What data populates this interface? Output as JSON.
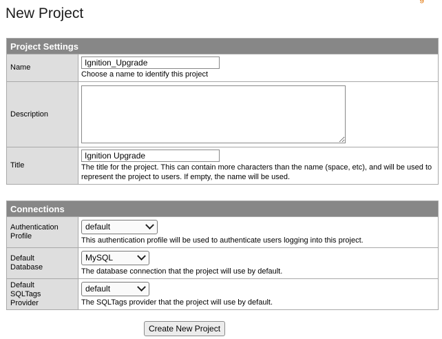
{
  "page": {
    "title": "New Project",
    "top_link": "g"
  },
  "project_settings": {
    "header": "Project Settings",
    "name": {
      "label": "Name",
      "value": "Ignition_Upgrade",
      "hint": "Choose a name to identify this project"
    },
    "description": {
      "label": "Description",
      "value": ""
    },
    "title": {
      "label": "Title",
      "value": "Ignition Upgrade",
      "hint": "The title for the project. This can contain more characters than the name (space, etc), and will be used to represent the project to users. If empty, the name will be used."
    }
  },
  "connections": {
    "header": "Connections",
    "auth_profile": {
      "label_line1": "Authentication",
      "label_line2": "Profile",
      "selected": "default",
      "hint": "This authentication profile will be used to authenticate users logging into this project."
    },
    "default_database": {
      "label_line1": "Default",
      "label_line2": "Database",
      "selected": "MySQL",
      "hint": "The database connection that the project will use by default."
    },
    "sqltags_provider": {
      "label_line1": "Default",
      "label_line2": "SQLTags",
      "label_line3": "Provider",
      "selected": "default",
      "hint": "The SQLTags provider that the project will use by default."
    }
  },
  "actions": {
    "create_label": "Create New Project"
  }
}
